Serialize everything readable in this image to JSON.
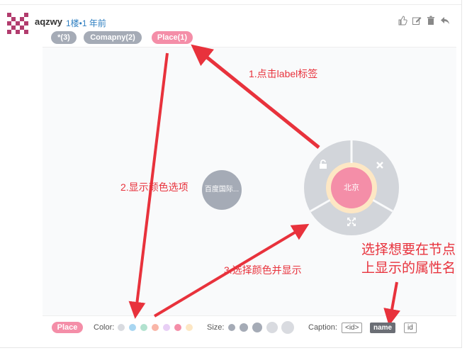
{
  "post": {
    "username": "aqzwy",
    "floor": "1楼•1 年前"
  },
  "label_tags": [
    {
      "text": "*(3)",
      "color": "#a5abb6"
    },
    {
      "text": "Comapny(2)",
      "color": "#a5abb6"
    },
    {
      "text": "Place(1)",
      "color": "#f48ea8"
    }
  ],
  "graph": {
    "nodes": [
      {
        "label": "百度国际...",
        "color": "#a5abb6"
      },
      {
        "label": "北京",
        "color": "#f48ea8",
        "selected": true
      }
    ],
    "ring_icons": [
      "unlock-icon",
      "close-icon",
      "expand-icon"
    ]
  },
  "annotations": {
    "step1": "1.点击label标签",
    "step2": "2.显示颜色选项",
    "step3": "3.选择颜色并显示",
    "caption_note_line1": "选择想要在节点",
    "caption_note_line2": "上显示的属性名"
  },
  "legend": {
    "active_label": "Place",
    "active_color": "#f48ea8",
    "color_label": "Color:",
    "colors": [
      "#d9dbe0",
      "#a8d6f1",
      "#b2e2cf",
      "#f9b6a8",
      "#e8cff5",
      "#f48ea8",
      "#fde7c4"
    ],
    "size_label": "Size:",
    "sizes": [
      "s1",
      "s2",
      "s3",
      "s4",
      "s5"
    ],
    "caption_label": "Caption:",
    "caption_options": [
      "<id>",
      "name",
      "id"
    ],
    "caption_selected": "name"
  }
}
